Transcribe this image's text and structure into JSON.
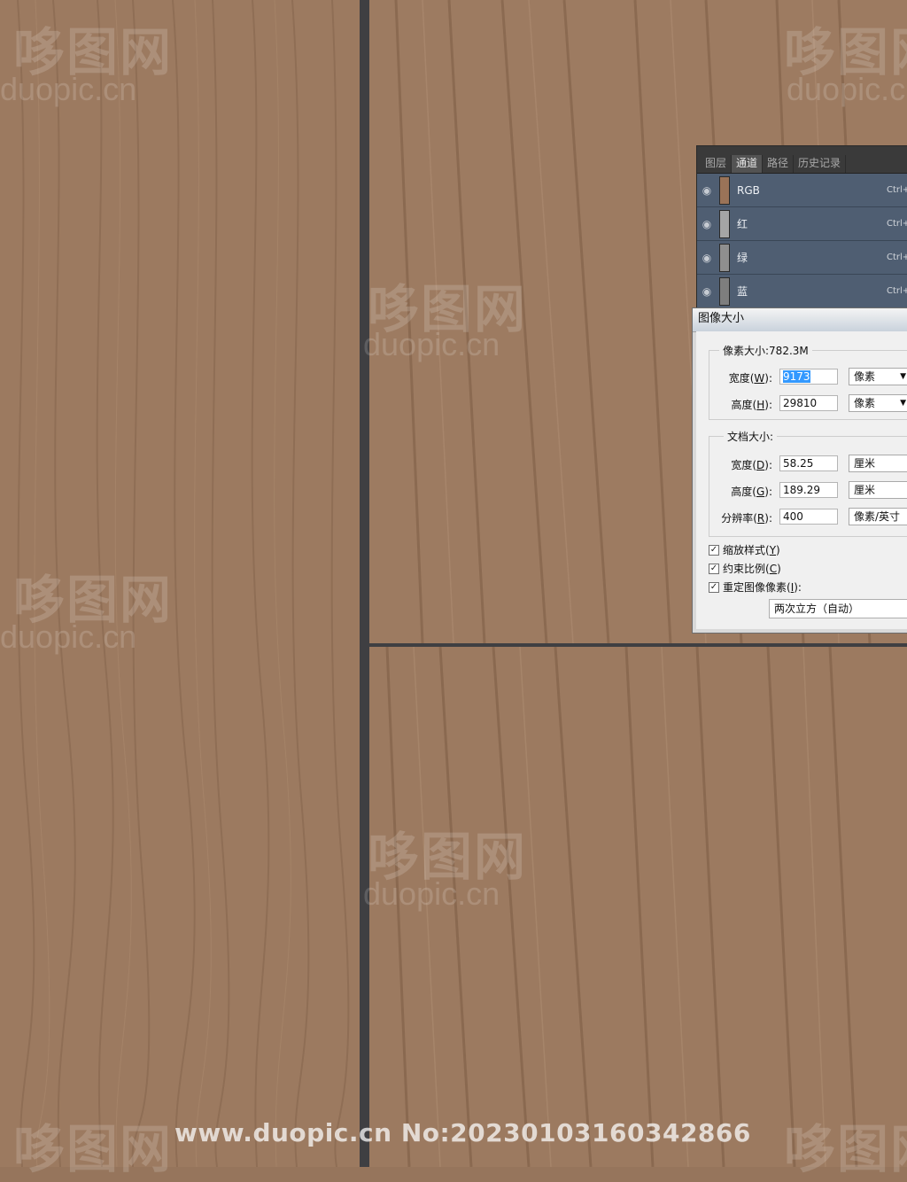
{
  "channels_panel": {
    "tabs": [
      "图层",
      "通道",
      "路径",
      "历史记录"
    ],
    "active_tab": "通道",
    "rows": [
      {
        "name": "RGB",
        "shortcut": "Ctrl+",
        "thumb_color": "#9a7358"
      },
      {
        "name": "红",
        "shortcut": "Ctrl+",
        "thumb_color": "#a5a5a5"
      },
      {
        "name": "绿",
        "shortcut": "Ctrl+",
        "thumb_color": "#8f8f8f"
      },
      {
        "name": "蓝",
        "shortcut": "Ctrl+",
        "thumb_color": "#7e7e7e"
      }
    ]
  },
  "image_size_dialog": {
    "title": "图像大小",
    "pixel_dimensions": {
      "label": "像素大小:782.3M",
      "width_label": "宽度(",
      "width_key": "W",
      "width_value": "9173",
      "width_unit": "像素",
      "height_label": "高度(",
      "height_key": "H",
      "height_value": "29810",
      "height_unit": "像素"
    },
    "document_size": {
      "label": "文档大小:",
      "width_label": "宽度(",
      "width_key": "D",
      "width_value": "58.25",
      "width_unit": "厘米",
      "height_label": "高度(",
      "height_key": "G",
      "height_value": "189.29",
      "height_unit": "厘米",
      "resolution_label": "分辨率(",
      "resolution_key": "R",
      "resolution_value": "400",
      "resolution_unit": "像素/英寸"
    },
    "checkboxes": [
      {
        "label": "缩放样式(",
        "key": "Y",
        "checked": true
      },
      {
        "label": "约束比例(",
        "key": "C",
        "checked": true
      },
      {
        "label": "重定图像像素(",
        "key": "I",
        "checked": true
      }
    ],
    "resample_method": "两次立方（自动）"
  },
  "watermarks": {
    "logo": "哆图网",
    "domain": "duopic.cn",
    "footer": "www.duopic.cn No:20230103160342866"
  }
}
